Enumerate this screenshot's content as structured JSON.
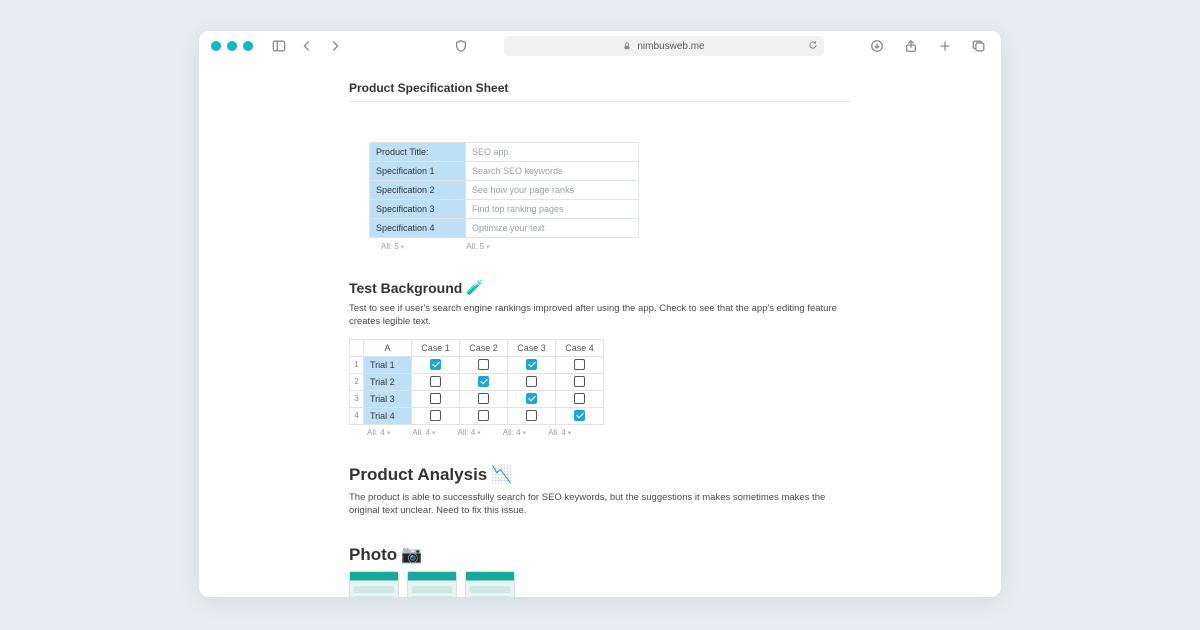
{
  "browser": {
    "url": "nimbusweb.me"
  },
  "doc": {
    "title": "Product Specification Sheet"
  },
  "spec_table": {
    "rows": [
      {
        "label": "Product Title:",
        "value": "SEO app"
      },
      {
        "label": "Specification 1",
        "value": "Search SEO keywords"
      },
      {
        "label": "Specification 2",
        "value": "See how your page ranks"
      },
      {
        "label": "Specification 3",
        "value": "Find top ranking pages"
      },
      {
        "label": "Specification 4",
        "value": "Optimize your text"
      }
    ],
    "counts": [
      "All: 5",
      "All: 5"
    ]
  },
  "test_bg": {
    "heading": "Test Background",
    "icon": "🧪",
    "body": "Test to see if user's search engine rankings improved after using the app. Check to see that the app's editing feature creates legible text."
  },
  "trial_table": {
    "cols": [
      "A",
      "Case 1",
      "Case 2",
      "Case 3",
      "Case 4"
    ],
    "rows": [
      {
        "n": "1",
        "label": "Trial 1",
        "cells": [
          true,
          false,
          true,
          false
        ]
      },
      {
        "n": "2",
        "label": "Trial 2",
        "cells": [
          false,
          true,
          false,
          false
        ]
      },
      {
        "n": "3",
        "label": "Trial 3",
        "cells": [
          false,
          false,
          true,
          false
        ]
      },
      {
        "n": "4",
        "label": "Trial 4",
        "cells": [
          false,
          false,
          false,
          true
        ]
      }
    ],
    "counts": [
      "All: 4",
      "All: 4",
      "All: 4",
      "All: 4",
      "All: 4"
    ]
  },
  "analysis": {
    "heading": "Product Analysis",
    "icon": "📉",
    "body": "The product is able to successfully search for SEO keywords, but the suggestions it makes sometimes makes the original text unclear. Need to fix this issue."
  },
  "photo": {
    "heading": "Photo",
    "icon": "📷"
  }
}
